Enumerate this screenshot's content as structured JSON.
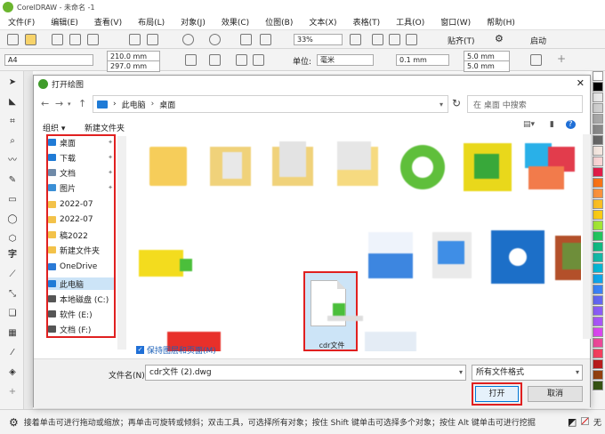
{
  "app": {
    "title": "CorelDRAW - 未命名 -1",
    "menu": [
      "文件(F)",
      "编辑(E)",
      "查看(V)",
      "布局(L)",
      "对象(J)",
      "效果(C)",
      "位图(B)",
      "文本(X)",
      "表格(T)",
      "工具(O)",
      "窗口(W)",
      "帮助(H)"
    ],
    "zoom": "33%",
    "snap_label": "贴齐(T)",
    "launch_label": "启动",
    "page_size": "A4",
    "width": "210.0 mm",
    "height": "297.0 mm",
    "unit_label": "单位:",
    "unit_value": "毫米",
    "nudge": "0.1 mm",
    "dup_x": "5.0 mm",
    "dup_y": "5.0 mm",
    "status_text": "接着单击可进行拖动或缩放；再单击可旋转或倾斜；双击工具，可选择所有对象；按住 Shift 键单击可选择多个对象；按住 Alt 键单击可进行挖掘",
    "status_fill": "无"
  },
  "dialog": {
    "title": "打开绘图",
    "close": "✕",
    "breadcrumb": [
      "此电脑",
      "桌面"
    ],
    "search_placeholder": "在 桌面 中搜索",
    "organize": "组织 ▾",
    "new_folder": "新建文件夹",
    "nav_items": [
      {
        "label": "桌面",
        "icon": "desktop-icon",
        "pinned": true,
        "color": "#1f7bd6"
      },
      {
        "label": "下载",
        "icon": "download-icon",
        "pinned": true,
        "color": "#1f7bd6"
      },
      {
        "label": "文档",
        "icon": "document-icon",
        "pinned": true,
        "color": "#6f8aa8"
      },
      {
        "label": "图片",
        "icon": "picture-icon",
        "pinned": true,
        "color": "#3a8fd6"
      },
      {
        "label": "2022-07",
        "icon": "folder-icon",
        "pinned": false,
        "color": "#f3c24a"
      },
      {
        "label": "2022-07",
        "icon": "folder-icon",
        "pinned": false,
        "color": "#f3c24a"
      },
      {
        "label": "稿2022",
        "icon": "folder-icon",
        "pinned": false,
        "color": "#f3c24a"
      },
      {
        "label": "新建文件夹",
        "icon": "folder-icon",
        "pinned": false,
        "color": "#f3c24a"
      },
      {
        "label": "OneDrive",
        "icon": "cloud-icon",
        "pinned": false,
        "color": "#2a7ad6"
      },
      {
        "label": "此电脑",
        "icon": "computer-icon",
        "pinned": false,
        "color": "#1f7bd6"
      },
      {
        "label": "本地磁盘 (C:)",
        "icon": "drive-icon",
        "pinned": false,
        "color": "#555555"
      },
      {
        "label": "软件 (E:)",
        "icon": "drive-icon",
        "pinned": false,
        "color": "#555555"
      },
      {
        "label": "文档 (F:)",
        "icon": "drive-icon",
        "pinned": false,
        "color": "#555555"
      }
    ],
    "selected_file": "cdr文件 (2).dwg",
    "keep_layers": "保持图层和页面(M)",
    "filename_label": "文件名(N):",
    "filename_value": "cdr文件 (2).dwg",
    "filetype": "所有文件格式",
    "open_button": "打开",
    "cancel_button": "取消"
  },
  "colors": {
    "accent": "#0078d7",
    "highlight": "#e02020",
    "selection": "#cce4f7"
  }
}
